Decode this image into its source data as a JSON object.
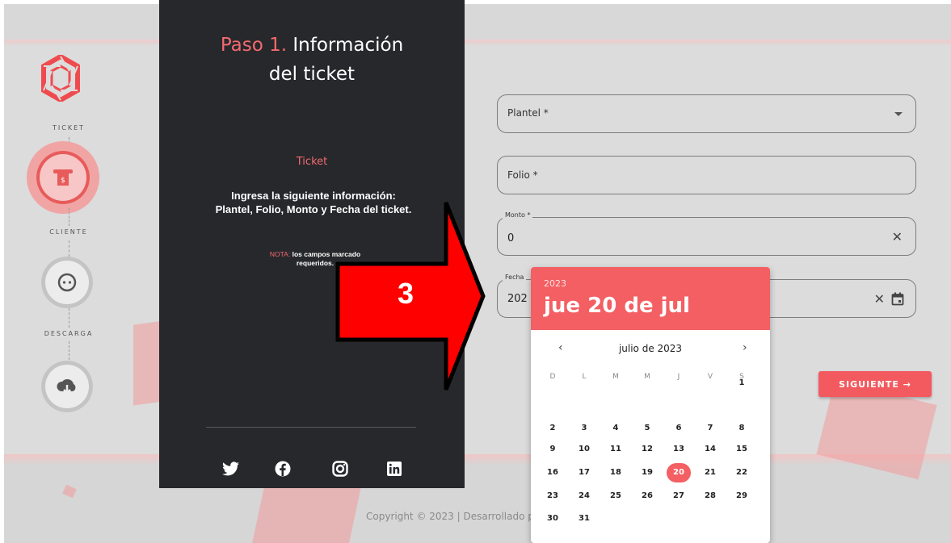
{
  "stepper": {
    "steps": [
      {
        "label": "TICKET",
        "icon": "receipt-icon"
      },
      {
        "label": "CLIENTE",
        "icon": "chat-icon"
      },
      {
        "label": "DESCARGA",
        "icon": "cloud-download-icon"
      }
    ]
  },
  "panel": {
    "title_step": "Paso 1.",
    "title_rest_1": "Información",
    "title_rest_2": "del ticket",
    "subtitle": "Ticket",
    "description": "Ingresa la siguiente información: Plantel, Folio, Monto y Fecha del ticket.",
    "note_label": "NOTA:",
    "note_text_line1": "los campos marcado",
    "note_text_line2": "requeridos.",
    "social": [
      "twitter-icon",
      "facebook-icon",
      "instagram-icon",
      "linkedin-icon"
    ]
  },
  "form": {
    "plantel_label": "Plantel *",
    "folio_label": "Folio *",
    "monto_label": "Monto *",
    "monto_value": "0",
    "fecha_label": "Fecha",
    "fecha_value": "202",
    "next_button": "SIGUIENTE →"
  },
  "overlay": {
    "arrow_label": "3",
    "arrow_color": "#ff0000"
  },
  "calendar": {
    "year": "2023",
    "selected_display": "jue 20 de jul",
    "month_label": "julio de 2023",
    "prev": "‹",
    "next": "›",
    "weekdays": [
      "D",
      "L",
      "M",
      "M",
      "J",
      "V",
      "S"
    ],
    "weeks": [
      [
        "",
        "",
        "",
        "",
        "",
        "",
        "1"
      ],
      [
        "2",
        "3",
        "4",
        "5",
        "6",
        "7",
        "8"
      ],
      [
        "9",
        "10",
        "11",
        "12",
        "13",
        "14",
        "15"
      ],
      [
        "16",
        "17",
        "18",
        "19",
        "20",
        "21",
        "22"
      ],
      [
        "23",
        "24",
        "25",
        "26",
        "27",
        "28",
        "29"
      ],
      [
        "30",
        "31",
        "",
        "",
        "",
        "",
        ""
      ]
    ],
    "selected_day": "20"
  },
  "footer": {
    "text": "Copyright © 2023 | Desarrollado p"
  },
  "colors": {
    "accent": "#f35f63",
    "panel": "#27282c"
  }
}
